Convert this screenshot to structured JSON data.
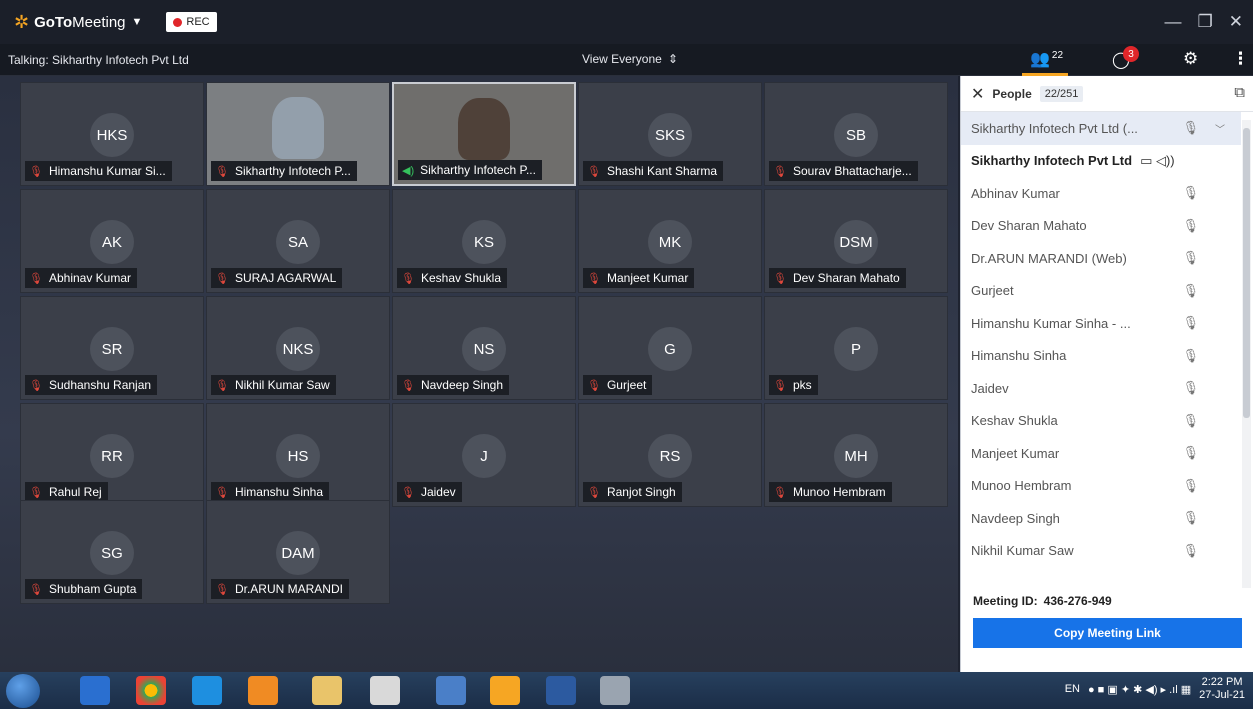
{
  "title_bar": {
    "brand_goto": "GoTo",
    "brand_meeting": "Meeting",
    "rec_label": "REC"
  },
  "sub_bar": {
    "talking": "Talking: Sikharthy Infotech Pvt Ltd",
    "view_everyone": "View Everyone",
    "people_count": "22",
    "chat_badge": "3"
  },
  "tiles": [
    {
      "initials": "HKS",
      "name": "Himanshu Kumar Si...",
      "muted": true
    },
    {
      "initials": "",
      "name": "Sikharthy Infotech P...",
      "muted": true,
      "video": true
    },
    {
      "initials": "",
      "name": "Sikharthy Infotech P...",
      "muted": false,
      "speaking": true,
      "video": true
    },
    {
      "initials": "SKS",
      "name": "Shashi Kant Sharma",
      "muted": true
    },
    {
      "initials": "SB",
      "name": "Sourav Bhattacharje...",
      "muted": true
    },
    {
      "initials": "AK",
      "name": "Abhinav Kumar",
      "muted": true
    },
    {
      "initials": "SA",
      "name": "SURAJ AGARWAL",
      "muted": true
    },
    {
      "initials": "KS",
      "name": "Keshav Shukla",
      "muted": true
    },
    {
      "initials": "MK",
      "name": "Manjeet Kumar",
      "muted": true
    },
    {
      "initials": "DSM",
      "name": "Dev Sharan Mahato",
      "muted": true
    },
    {
      "initials": "SR",
      "name": "Sudhanshu Ranjan",
      "muted": true
    },
    {
      "initials": "NKS",
      "name": "Nikhil Kumar Saw",
      "muted": true
    },
    {
      "initials": "NS",
      "name": "Navdeep Singh",
      "muted": true
    },
    {
      "initials": "G",
      "name": "Gurjeet",
      "muted": true
    },
    {
      "initials": "P",
      "name": "pks",
      "muted": true
    },
    {
      "initials": "RR",
      "name": "Rahul Rej",
      "muted": true
    },
    {
      "initials": "HS",
      "name": "Himanshu Sinha",
      "muted": true
    },
    {
      "initials": "J",
      "name": "Jaidev",
      "muted": true
    },
    {
      "initials": "RS",
      "name": "Ranjot Singh",
      "muted": true
    },
    {
      "initials": "MH",
      "name": "Munoo Hembram",
      "muted": true
    },
    {
      "initials": "SG",
      "name": "Shubham Gupta",
      "muted": true
    },
    {
      "initials": "DAM",
      "name": "Dr.ARUN MARANDI",
      "muted": true
    }
  ],
  "people_panel": {
    "title": "People",
    "count": "22/251",
    "rows": [
      {
        "name": "Sikharthy Infotech Pvt Ltd (...",
        "state": "active"
      },
      {
        "name": "Sikharthy Infotech Pvt Ltd",
        "state": "presenter"
      },
      {
        "name": "Abhinav Kumar"
      },
      {
        "name": "Dev Sharan Mahato"
      },
      {
        "name": "Dr.ARUN MARANDI  (Web)"
      },
      {
        "name": "Gurjeet"
      },
      {
        "name": "Himanshu Kumar Sinha  - ..."
      },
      {
        "name": "Himanshu Sinha"
      },
      {
        "name": "Jaidev"
      },
      {
        "name": "Keshav Shukla"
      },
      {
        "name": "Manjeet Kumar"
      },
      {
        "name": "Munoo Hembram"
      },
      {
        "name": "Navdeep Singh"
      },
      {
        "name": "Nikhil Kumar Saw"
      }
    ],
    "meeting_id_label": "Meeting ID:",
    "meeting_id": "436-276-949",
    "copy_link": "Copy Meeting Link"
  },
  "taskbar": {
    "lang": "EN",
    "time": "2:22 PM",
    "date": "27-Jul-21"
  }
}
